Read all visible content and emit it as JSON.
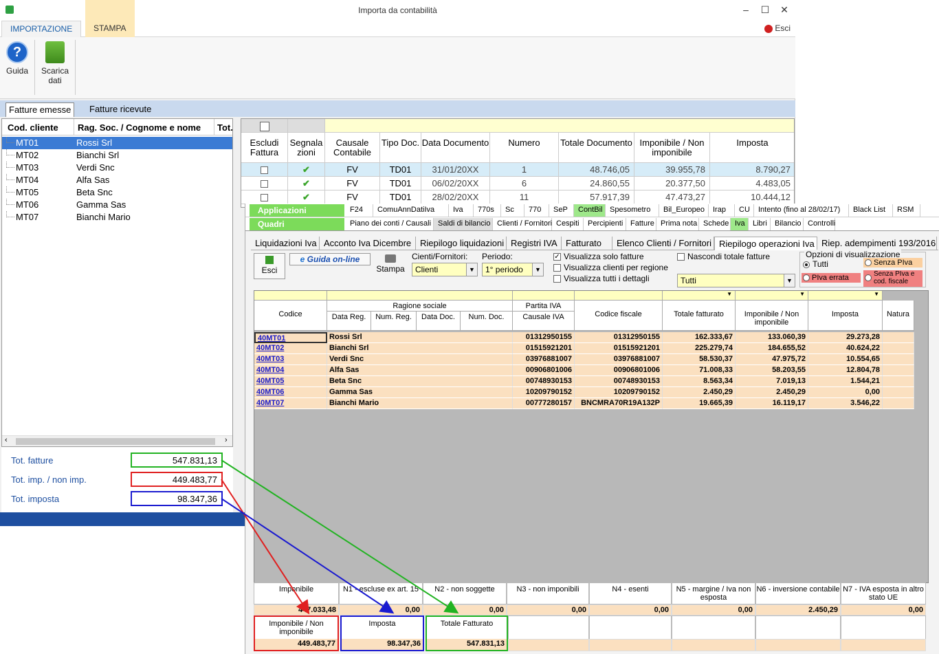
{
  "window": {
    "title": "Importa da contabilità",
    "min": "–",
    "max": "☐",
    "close": "✕"
  },
  "ribbon": {
    "tabs": [
      "IMPORTAZIONE",
      "STAMPA"
    ],
    "esci": "Esci",
    "guida": "Guida",
    "scarica_line1": "Scarica",
    "scarica_line2": "dati"
  },
  "doc_tabs": [
    "Fatture emesse",
    "Fatture ricevute"
  ],
  "left": {
    "headers": [
      "Cod. cliente",
      "Rag. Soc. / Cognome e nome",
      "Tot."
    ],
    "rows": [
      {
        "code": "MT01",
        "name": "Rossi Srl"
      },
      {
        "code": "MT02",
        "name": "Bianchi Srl"
      },
      {
        "code": "MT03",
        "name": "Verdi Snc"
      },
      {
        "code": "MT04",
        "name": "Alfa Sas"
      },
      {
        "code": "MT05",
        "name": "Beta Snc"
      },
      {
        "code": "MT06",
        "name": "Gamma Sas"
      },
      {
        "code": "MT07",
        "name": "Bianchi Mario"
      }
    ],
    "totals": [
      {
        "label": "Tot. fatture",
        "value": "547.831,13",
        "color": "#22b322"
      },
      {
        "label": "Tot. imp. / non imp.",
        "value": "449.483,77",
        "color": "#e02020"
      },
      {
        "label": "Tot. imposta",
        "value": "98.347,36",
        "color": "#1a1ad0"
      }
    ]
  },
  "topgrid": {
    "headers": [
      "Escludi Fattura",
      "Segnala zioni",
      "Causale Contabile",
      "Tipo Doc.",
      "Data Documento",
      "Numero",
      "Totale Documento",
      "Imponibile / Non imponibile",
      "Imposta"
    ],
    "rows": [
      {
        "causale": "FV",
        "tipo": "TD01",
        "data": "31/01/20XX",
        "numero": "1",
        "totale": "48.746,05",
        "imponibile": "39.955,78",
        "imposta": "8.790,27"
      },
      {
        "causale": "FV",
        "tipo": "TD01",
        "data": "06/02/20XX",
        "numero": "6",
        "totale": "24.860,55",
        "imponibile": "20.377,50",
        "imposta": "4.483,05"
      },
      {
        "causale": "FV",
        "tipo": "TD01",
        "data": "28/02/20XX",
        "numero": "11",
        "totale": "57.917,39",
        "imponibile": "47.473,27",
        "imposta": "10.444,12"
      }
    ]
  },
  "app": {
    "applicazioni": "Applicazioni",
    "quadri": "Quadri",
    "row1": [
      "F24",
      "ComuAnnDatiIva",
      "Iva",
      "770s",
      "Sc",
      "770",
      "SeP",
      "ContBil",
      "Spesometro",
      "Bil_Europeo",
      "Irap",
      "CU",
      "Intento (fino al 28/02/17)",
      "Black List",
      "RSM"
    ],
    "row2": [
      "Piano dei conti / Causali",
      "Saldi di bilancio",
      "Clienti / Fornitori",
      "Cespiti",
      "Percipienti",
      "Fatture",
      "Prima nota",
      "Schede",
      "Iva",
      "Libri",
      "Bilancio",
      "Controlli"
    ],
    "sectabs": [
      "Liquidazioni Iva",
      "Acconto Iva Dicembre",
      "Riepilogo liquidazioni",
      "Registri IVA",
      "Fatturato",
      "Elenco Clienti / Fornitori",
      "Riepilogo operazioni Iva",
      "Riep. adempimenti 193/2016"
    ],
    "esci": "Esci",
    "guida_online": "Guida on-line",
    "stampa": "Stampa",
    "cf_label": "Cienti/Fornitori:",
    "cf_value": "Clienti",
    "periodo_label": "Periodo:",
    "periodo_value": "1° periodo",
    "chk1": "Visualizza solo fatture",
    "chk2": "Visualizza clienti per regione",
    "chk3": "Visualizza tutti i dettagli",
    "chk4": "Nascondi totale fatture",
    "tutti_combo": "Tutti",
    "opz_title": "Opzioni di visualizzazione",
    "opz_tutti": "Tutti",
    "opz_senza_piva": "Senza PIva",
    "opz_piva_errata": "PIva errata",
    "opz_senza_both": "Senza PIva e cod. fiscale"
  },
  "maingrid": {
    "h_codice": "Codice",
    "h_ragione": "Ragione sociale",
    "h_datareg": "Data Reg.",
    "h_numreg": "Num. Reg.",
    "h_datadoc": "Data Doc.",
    "h_numdoc": "Num. Doc.",
    "h_piva": "Partita IVA",
    "h_causaleiva": "Causale IVA",
    "h_cf": "Codice fiscale",
    "h_totfat": "Totale fatturato",
    "h_impon": "Imponibile / Non imponibile",
    "h_imposta": "Imposta",
    "h_natura": "Natura",
    "rows": [
      {
        "code": "40MT01",
        "name": "Rossi Srl",
        "piva": "01312950155",
        "cf": "01312950155",
        "tot": "162.333,67",
        "imp": "133.060,39",
        "iva": "29.273,28"
      },
      {
        "code": "40MT02",
        "name": "Bianchi Srl",
        "piva": "01515921201",
        "cf": "01515921201",
        "tot": "225.279,74",
        "imp": "184.655,52",
        "iva": "40.624,22"
      },
      {
        "code": "40MT03",
        "name": "Verdi Snc",
        "piva": "03976881007",
        "cf": "03976881007",
        "tot": "58.530,37",
        "imp": "47.975,72",
        "iva": "10.554,65"
      },
      {
        "code": "40MT04",
        "name": "Alfa Sas",
        "piva": "00906801006",
        "cf": "00906801006",
        "tot": "71.008,33",
        "imp": "58.203,55",
        "iva": "12.804,78"
      },
      {
        "code": "40MT05",
        "name": "Beta Snc",
        "piva": "00748930153",
        "cf": "00748930153",
        "tot": "8.563,34",
        "imp": "7.019,13",
        "iva": "1.544,21"
      },
      {
        "code": "40MT06",
        "name": "Gamma Sas",
        "piva": "10209790152",
        "cf": "10209790152",
        "tot": "2.450,29",
        "imp": "2.450,29",
        "iva": "0,00"
      },
      {
        "code": "40MT07",
        "name": "Bianchi Mario",
        "piva": "00777280157",
        "cf": "BNCMRA70R19A132P",
        "tot": "19.665,39",
        "imp": "16.119,17",
        "iva": "3.546,22"
      }
    ]
  },
  "bottom": {
    "headers": [
      "Imponibile",
      "N1 - escluse ex art. 15",
      "N2 - non soggette",
      "N3 - non imponibili",
      "N4 - esenti",
      "N5 - margine / Iva non esposta",
      "N6 - inversione contabile",
      "N7 - IVA esposta in altro stato UE"
    ],
    "values": [
      "447.033,48",
      "0,00",
      "0,00",
      "0,00",
      "0,00",
      "0,00",
      "2.450,29",
      "0,00"
    ],
    "sum_headers": [
      "Imponibile / Non imponibile",
      "Imposta",
      "Totale Fatturato"
    ],
    "sum_values": [
      "449.483,77",
      "98.347,36",
      "547.831,13"
    ]
  },
  "colors": {
    "green": "#22b322",
    "red": "#e02020",
    "blue": "#1a1ad0",
    "row_orange": "#fbe0c0",
    "accent_blue": "#1e4fa0"
  }
}
